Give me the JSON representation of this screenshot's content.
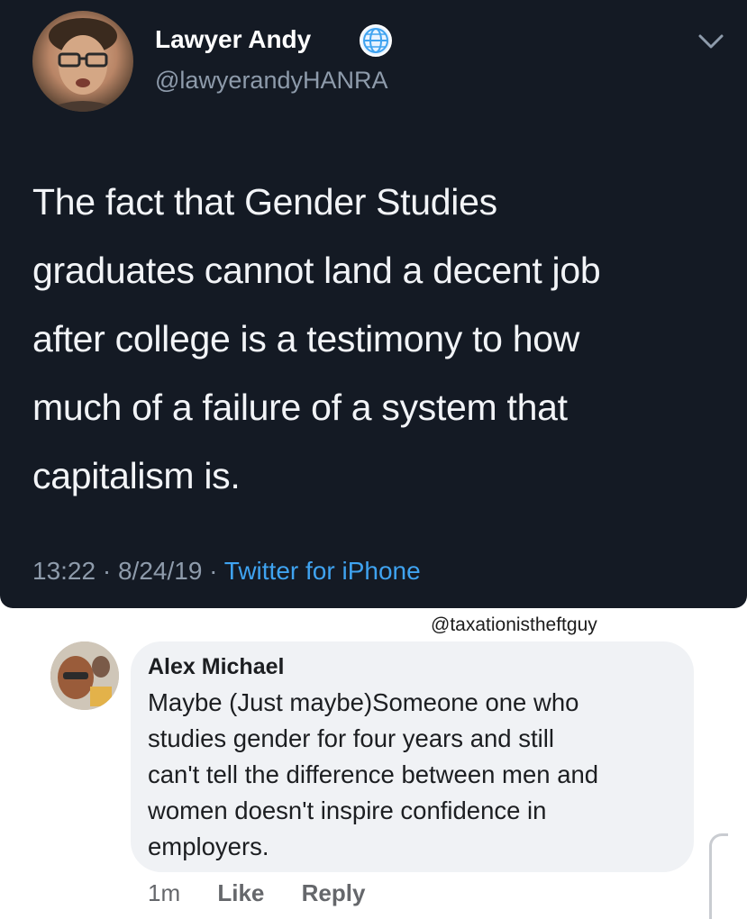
{
  "tweet": {
    "author_name": "Lawyer Andy",
    "handle": "@lawyerandyHANRA",
    "text_lines": [
      "The fact that Gender Studies",
      "graduates cannot land a decent job",
      "after college is a testimony to how",
      "much of a failure of a system that",
      "capitalism is."
    ],
    "time": "13:22",
    "date": "8/24/19",
    "source": "Twitter for iPhone",
    "separator": " · ",
    "icons": [
      "avatar-photo",
      "globe-icon",
      "chevron-down-icon"
    ]
  },
  "watermark": "@taxationistheftguy",
  "comment": {
    "author_name": "Alex Michael",
    "text_lines": [
      "Maybe (Just maybe)Someone one who",
      "studies gender for four years and still",
      "can't tell the difference between men and",
      "women doesn't inspire confidence in",
      "employers."
    ],
    "age": "1m",
    "like_label": "Like",
    "reply_label": "Reply"
  },
  "colors": {
    "tweet_bg": "#141a24",
    "link_blue": "#3fa3f0",
    "muted_gray": "#8e9bab",
    "bubble_bg": "#f0f2f5"
  }
}
